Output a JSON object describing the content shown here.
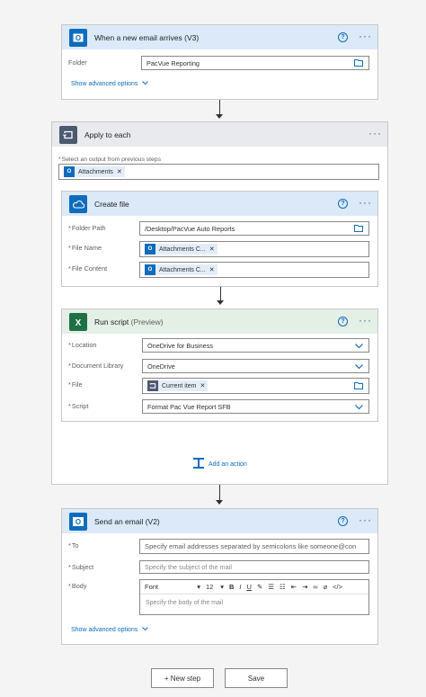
{
  "email_trigger": {
    "title": "When a new email arrives (V3)",
    "icon": "outlook-icon",
    "folder_label": "Folder",
    "folder_value": "PacVue Reporting",
    "advanced": "Show advanced options"
  },
  "apply_each": {
    "title": "Apply to each",
    "select_label": "Select an output from previous steps",
    "token": "Attachments"
  },
  "create_file": {
    "title": "Create file",
    "folder_path_label": "Folder Path",
    "folder_path_value": "/Desktop/PacVue Auto Reports",
    "file_name_label": "File Name",
    "file_name_token": "Attachments C...",
    "file_content_label": "File Content",
    "file_content_token": "Attachments C..."
  },
  "run_script": {
    "title": "Run script",
    "title_suffix": "(Preview)",
    "location_label": "Location",
    "location_value": "OneDrive for Business",
    "library_label": "Document Library",
    "library_value": "OneDrive",
    "file_label": "File",
    "file_token": "Current item",
    "script_label": "Script",
    "script_value": "Format Pac Vue Report SFB"
  },
  "add_action": "Add an action",
  "send_email": {
    "title": "Send an email (V2)",
    "to_label": "To",
    "to_placeholder": "Specify email addresses separated by semicolons like someone@con",
    "subject_label": "Subject",
    "subject_placeholder": "Specify the subject of the mail",
    "body_label": "Body",
    "font_value": "Font",
    "font_size": "12",
    "body_placeholder": "Specify the body of the mail",
    "advanced": "Show advanced options"
  },
  "footer": {
    "new_step": "+ New step",
    "save": "Save"
  },
  "colors": {
    "accent": "#0f6cbd",
    "outlook": "#0f6cbd",
    "onedrive": "#0f6cbd",
    "excel": "#1e7145",
    "loop": "#4b5a70"
  }
}
